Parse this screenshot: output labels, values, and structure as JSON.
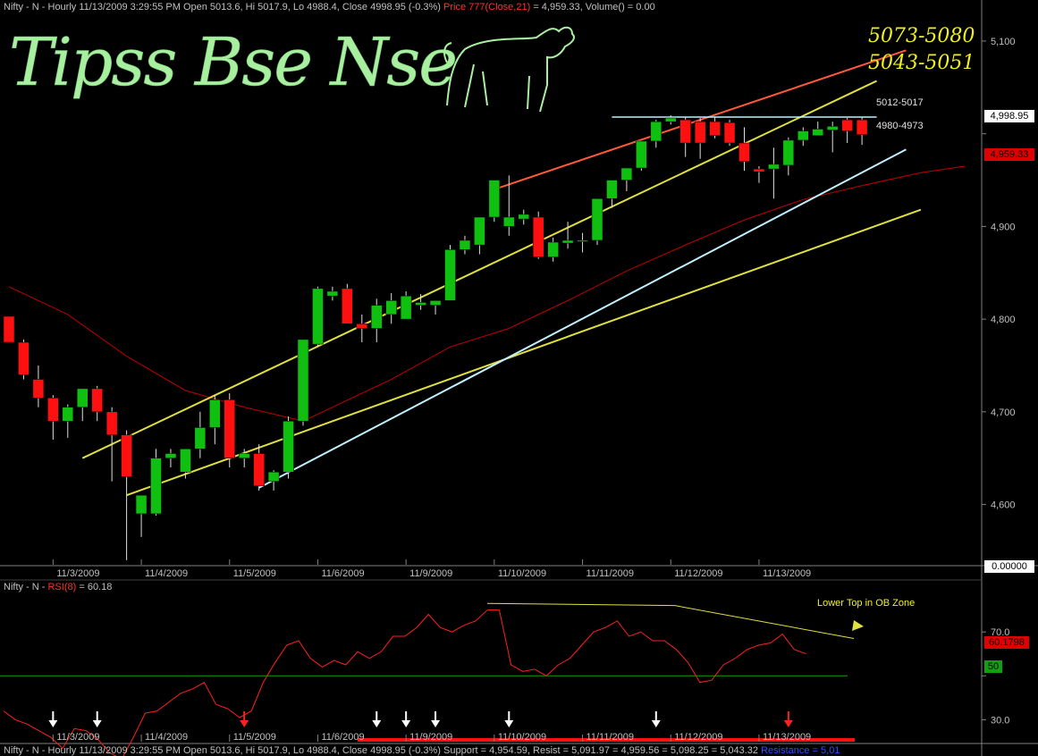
{
  "header": {
    "symbol": "Nifty - N - Hourly 11/13/2009 3:29:55 PM Open 5013.6, Hi 5017.9, Lo 4988.4, Close 4998.95 (-0.3%)",
    "ma_label": "Price 777(Close,21)",
    "ma_value": "= 4,959.33, Volume() = 0.00"
  },
  "rsi_header": {
    "prefix": "Nifty - N - ",
    "label": "RSI(8)",
    "value": "= 60.18"
  },
  "footer": {
    "prefix": "Nifty - N - Hourly 11/13/2009 3:29:55 PM Open 5013.6, Hi 5017.9, Lo 4988.4, Close 4998.95 (-0.3%)",
    "support": "Support = 4,954.59, Resist = 5,091.97 = 4,959.56",
    "resistance_vals": "= 5,098.25 = 5,043.32",
    "resistance_label": "Resistance = 5,01"
  },
  "watermark": {
    "text": "Tipss Bse Nse",
    "color": "#a8f0a0"
  },
  "targets": {
    "upper": "5073-5080",
    "lower": "5043-5051"
  },
  "annotations": {
    "resistance_zone": "5012-5017",
    "support_zone": "4980-4973",
    "rsi_note": "Lower Top in OB Zone"
  },
  "price_tags": {
    "close": "4,998.95",
    "ma": "4,959.33",
    "zero": "0.00000",
    "rsi": "60.1798",
    "rsi_mid": "50"
  },
  "colors": {
    "up": "#10c010",
    "down": "#ff1010",
    "ma": "#c00000",
    "channel": "#e0e040",
    "upper_channel": "#ff5a3a",
    "trend": "#c0f0ff",
    "rsi": "#ff2020",
    "grid_text": "#c0c0c0"
  },
  "chart_data": [
    {
      "type": "candlestick",
      "xlabel": "",
      "ylabel": "",
      "ylim": [
        4535,
        5125
      ],
      "yticks": [
        4600,
        4700,
        4800,
        4900,
        5000,
        5100
      ],
      "ytick_labels": [
        "4,600",
        "4,700",
        "4,800",
        "4,900",
        "",
        "5,100"
      ],
      "date_labels": [
        {
          "label": "11/3/2009",
          "bar": 3
        },
        {
          "label": "11/4/2009",
          "bar": 9
        },
        {
          "label": "11/5/2009",
          "bar": 15
        },
        {
          "label": "11/6/2009",
          "bar": 21
        },
        {
          "label": "11/9/2009",
          "bar": 27
        },
        {
          "label": "11/10/2009",
          "bar": 33
        },
        {
          "label": "11/11/2009",
          "bar": 39
        },
        {
          "label": "11/12/2009",
          "bar": 45
        },
        {
          "label": "11/13/2009",
          "bar": 51
        }
      ],
      "candles": [
        [
          4803,
          4803,
          4775,
          4775
        ],
        [
          4775,
          4778,
          4735,
          4740
        ],
        [
          4735,
          4750,
          4705,
          4715
        ],
        [
          4715,
          4718,
          4670,
          4690
        ],
        [
          4690,
          4708,
          4672,
          4705
        ],
        [
          4705,
          4725,
          4690,
          4725
        ],
        [
          4725,
          4728,
          4690,
          4700
        ],
        [
          4700,
          4705,
          4625,
          4675
        ],
        [
          4675,
          4680,
          4540,
          4630
        ],
        [
          4590,
          4595,
          4565,
          4610
        ],
        [
          4590,
          4660,
          4588,
          4650
        ],
        [
          4650,
          4660,
          4640,
          4655
        ],
        [
          4635,
          4660,
          4628,
          4660
        ],
        [
          4660,
          4700,
          4650,
          4683
        ],
        [
          4683,
          4718,
          4665,
          4713
        ],
        [
          4713,
          4720,
          4640,
          4650
        ],
        [
          4650,
          4660,
          4640,
          4655
        ],
        [
          4655,
          4665,
          4615,
          4620
        ],
        [
          4625,
          4637,
          4615,
          4635
        ],
        [
          4635,
          4695,
          4628,
          4690
        ],
        [
          4690,
          4775,
          4685,
          4778
        ],
        [
          4773,
          4835,
          4770,
          4833
        ],
        [
          4825,
          4835,
          4820,
          4830
        ],
        [
          4833,
          4838,
          4795,
          4795
        ],
        [
          4795,
          4805,
          4775,
          4790
        ],
        [
          4790,
          4822,
          4775,
          4815
        ],
        [
          4805,
          4828,
          4795,
          4820
        ],
        [
          4800,
          4830,
          4800,
          4825
        ],
        [
          4815,
          4827,
          4810,
          4818
        ],
        [
          4815,
          4820,
          4805,
          4820
        ],
        [
          4820,
          4880,
          4820,
          4875
        ],
        [
          4875,
          4890,
          4870,
          4885
        ],
        [
          4880,
          4910,
          4870,
          4910
        ],
        [
          4910,
          4950,
          4905,
          4950
        ],
        [
          4900,
          4955,
          4890,
          4910
        ],
        [
          4908,
          4918,
          4902,
          4913
        ],
        [
          4910,
          4916,
          4865,
          4867
        ],
        [
          4867,
          4888,
          4862,
          4883
        ],
        [
          4882,
          4905,
          4876,
          4885
        ],
        [
          4885,
          4893,
          4872,
          4885
        ],
        [
          4885,
          4930,
          4880,
          4930
        ],
        [
          4930,
          4950,
          4920,
          4950
        ],
        [
          4950,
          4963,
          4938,
          4963
        ],
        [
          4963,
          4990,
          4960,
          4992
        ],
        [
          4992,
          5015,
          4985,
          5013
        ],
        [
          5013,
          5020,
          5010,
          5017
        ],
        [
          5015,
          5018,
          4975,
          4990
        ],
        [
          5013,
          5017,
          4973,
          4990
        ],
        [
          5013,
          5018,
          4995,
          4998
        ],
        [
          5012,
          5015,
          4987,
          4990
        ],
        [
          4990,
          5007,
          4960,
          4970
        ],
        [
          4962,
          4965,
          4947,
          4959
        ],
        [
          4962,
          4985,
          4930,
          4967
        ],
        [
          4966,
          4996,
          4955,
          4993
        ],
        [
          4993,
          5007,
          4987,
          5003
        ],
        [
          4998,
          5013,
          4998,
          5005
        ],
        [
          5004,
          5013,
          4980,
          5008
        ],
        [
          5015,
          5017,
          4990,
          5003
        ],
        [
          5015,
          5018,
          4988,
          4999
        ]
      ],
      "ma21": [
        [
          0,
          4835
        ],
        [
          4,
          4805
        ],
        [
          8,
          4760
        ],
        [
          12,
          4723
        ],
        [
          16,
          4705
        ],
        [
          20,
          4690
        ],
        [
          22,
          4705
        ],
        [
          26,
          4735
        ],
        [
          30,
          4770
        ],
        [
          34,
          4790
        ],
        [
          38,
          4820
        ],
        [
          42,
          4852
        ],
        [
          46,
          4880
        ],
        [
          50,
          4907
        ],
        [
          54,
          4929
        ],
        [
          58,
          4944
        ],
        [
          62,
          4958
        ],
        [
          65,
          4965
        ]
      ],
      "lines": {
        "channel_upper": [
          [
            5,
            4650
          ],
          [
            59,
            5057
          ]
        ],
        "channel_lower": [
          [
            8,
            4610
          ],
          [
            62,
            4918
          ]
        ],
        "trend_support": [
          [
            17,
            4618
          ],
          [
            61,
            4983
          ]
        ],
        "upper_resistance": [
          [
            33,
            4940
          ],
          [
            61,
            5090
          ]
        ],
        "horizontal_resistance": [
          [
            41,
            5018
          ],
          [
            59,
            5018
          ]
        ]
      }
    },
    {
      "type": "line",
      "name": "RSI(8)",
      "ylim": [
        20,
        90
      ],
      "yticks": [
        30,
        50,
        70
      ],
      "ytick_labels": [
        "30.0",
        "",
        "70.0"
      ],
      "reference": 50,
      "values": [
        34,
        30,
        28,
        25,
        22,
        17,
        26,
        25,
        21,
        15,
        12,
        22,
        33,
        34,
        38,
        42,
        44,
        47,
        37,
        35,
        31,
        34,
        47,
        56,
        64,
        66,
        58,
        54,
        57,
        55,
        61,
        58,
        61,
        68,
        68,
        72,
        78,
        72,
        70,
        73,
        75,
        80,
        80,
        55,
        52,
        53,
        50,
        55,
        58,
        64,
        70,
        72,
        75,
        68,
        70,
        66,
        66,
        62,
        56,
        47,
        48,
        55,
        58,
        62,
        64,
        65,
        69,
        62,
        60
      ],
      "down_arrows": [
        3,
        6,
        16,
        25,
        27,
        29,
        34,
        44,
        53
      ],
      "down_arrows_red": [
        16,
        53
      ]
    }
  ]
}
